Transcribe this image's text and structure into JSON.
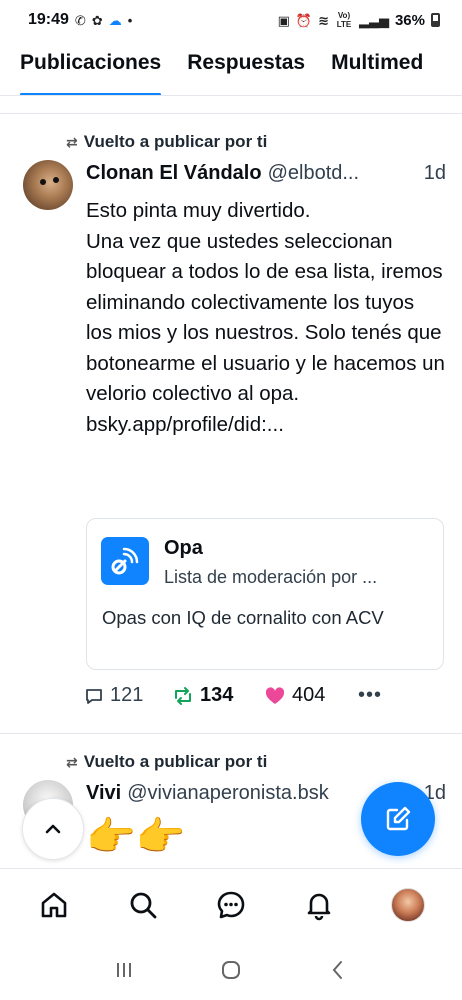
{
  "status_bar": {
    "time": "19:49",
    "battery": "36%",
    "network_label": "Vo) LTE"
  },
  "tabs": [
    {
      "label": "Publicaciones",
      "active": true
    },
    {
      "label": "Respuestas",
      "active": false
    },
    {
      "label": "Multimed",
      "active": false
    }
  ],
  "post1": {
    "repost_label": "Vuelto a publicar por ti",
    "author_name": "Clonan El Vándalo",
    "author_handle": "@elbotd...",
    "time": "1d",
    "text_lines": [
      "Esto pinta muy divertido.",
      "Una vez que ustedes seleccionan bloquear a todos lo de esa lista, iremos eliminando colectivamente los tuyos los mios y los nuestros. Solo tenés que botonearme el usuario y le hacemos un velorio colectivo al opa.",
      "bsky.app/profile/did:..."
    ],
    "embed": {
      "title": "Opa",
      "subtitle": "Lista de moderación por ...",
      "description": "Opas con IQ de cornalito con ACV"
    },
    "reply_count": "121",
    "repost_count": "134",
    "like_count": "404"
  },
  "post2": {
    "repost_label": "Vuelto a publicar por ti",
    "author_name": "Vivi",
    "author_handle": "@vivianaperonista.bsk",
    "time": "1d",
    "text": "👉👉"
  },
  "colors": {
    "accent": "#1083fe",
    "repost_green": "#13a35a",
    "like_pink": "#ec4899"
  }
}
